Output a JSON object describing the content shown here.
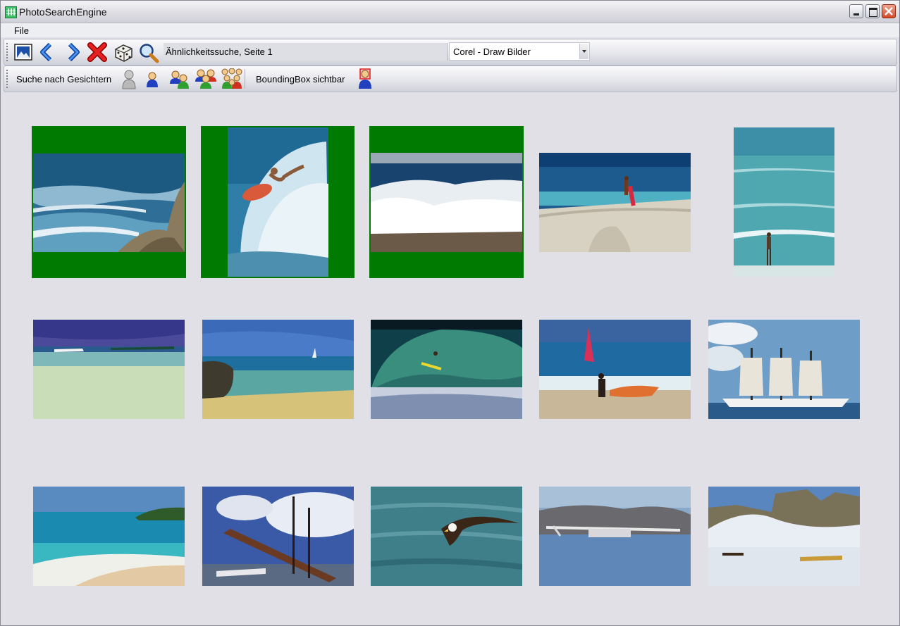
{
  "window": {
    "title": "PhotoSearchEngine"
  },
  "menu": {
    "file": "File"
  },
  "toolbar": {
    "icons": [
      "picture-icon",
      "arrow-left-icon",
      "arrow-right-icon",
      "red-x-icon",
      "dice-icon",
      "magnifier-icon"
    ],
    "search_status": "Ähnlichkeitssuche, Seite 1",
    "collection": {
      "selected": "Corel - Draw Bilder"
    }
  },
  "face_toolbar": {
    "search_label": "Suche nach Gesichtern",
    "face_icons": [
      "face-any-icon",
      "face-single-icon",
      "faces-two-icon",
      "faces-three-icon",
      "faces-group-icon"
    ],
    "bbox_label": "BoundingBox sichtbar"
  },
  "gallery": {
    "page": 1,
    "selected_count": 3,
    "images": [
      {
        "subject": "waves on rocky coast",
        "selected": true
      },
      {
        "subject": "surfer splash",
        "selected": true
      },
      {
        "subject": "breaking wave",
        "selected": true
      },
      {
        "subject": "woman walking on beach",
        "selected": false
      },
      {
        "subject": "woman standing in sea",
        "selected": false
      },
      {
        "subject": "speedboat on clear water",
        "selected": false
      },
      {
        "subject": "tropical coast with sailboat",
        "selected": false
      },
      {
        "subject": "surfer in barrel wave",
        "selected": false
      },
      {
        "subject": "windsurfer on beach",
        "selected": false
      },
      {
        "subject": "tall sailing ship",
        "selected": false
      },
      {
        "subject": "turquoise bay beach",
        "selected": false
      },
      {
        "subject": "sailing ship in harbor",
        "selected": false
      },
      {
        "subject": "eagle over water",
        "selected": false
      },
      {
        "subject": "seaplane on lake",
        "selected": false
      },
      {
        "subject": "dog sled on ice",
        "selected": false
      }
    ]
  },
  "colors": {
    "selection": "#007a00",
    "background": "#e1e0e6"
  }
}
